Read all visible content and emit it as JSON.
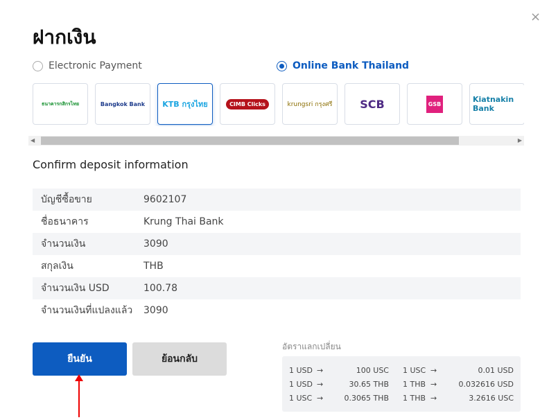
{
  "title": "ฝากเงิน",
  "close_icon": "×",
  "payment_options": [
    {
      "label": "Electronic Payment",
      "selected": false
    },
    {
      "label": "Online Bank Thailand",
      "selected": true
    }
  ],
  "banks": [
    {
      "label": "ธนาคารกสิกรไทย",
      "color": "#138f2d"
    },
    {
      "label": "Bangkok Bank",
      "color": "#1e3c8c"
    },
    {
      "label": "KTB กรุงไทย",
      "color": "#1ba5e1"
    },
    {
      "label": "CIMB Clicks",
      "color": "#b5121b"
    },
    {
      "label": "krungsri กรุงศรี",
      "color": "#8a6d00"
    },
    {
      "label": "SCB",
      "color": "#4e2a84"
    },
    {
      "label": "GSB",
      "color": "#e0207d"
    },
    {
      "label": "Kiatnakin Bank",
      "color": "#1680a8"
    }
  ],
  "confirm_heading": "Confirm deposit information",
  "details": [
    {
      "label": "บัญชีซื้อขาย",
      "value": "9602107"
    },
    {
      "label": "ชื่อธนาคาร",
      "value": "Krung Thai Bank"
    },
    {
      "label": "จำนวนเงิน",
      "value": "3090"
    },
    {
      "label": "สกุลเงิน",
      "value": "THB"
    },
    {
      "label": "จำนวนเงิน USD",
      "value": "100.78"
    },
    {
      "label": "จำนวนเงินที่แปลงแล้ว",
      "value": "3090"
    }
  ],
  "buttons": {
    "confirm": "ยืนยัน",
    "back": "ย้อนกลับ"
  },
  "rates_heading": "อัตราแลกเปลี่ยน",
  "arrow": "→",
  "rates": [
    [
      "1 USD",
      "100 USC",
      "1 USC",
      "0.01 USD"
    ],
    [
      "1 USD",
      "30.65 THB",
      "1 THB",
      "0.032616 USD"
    ],
    [
      "1 USC",
      "0.3065 THB",
      "1 THB",
      "3.2616 USC"
    ]
  ]
}
